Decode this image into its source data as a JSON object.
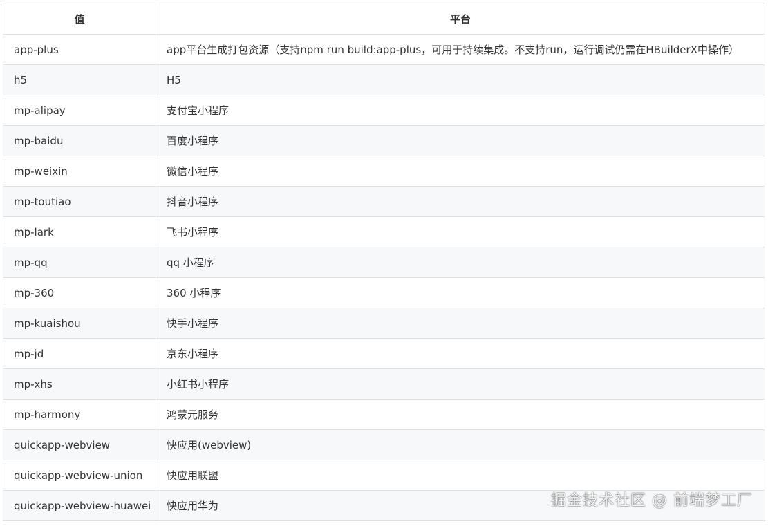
{
  "table": {
    "headers": [
      "值",
      "平台"
    ],
    "rows": [
      [
        "app-plus",
        "app平台生成打包资源（支持npm run build:app-plus，可用于持续集成。不支持run，运行调试仍需在HBuilderX中操作）"
      ],
      [
        "h5",
        "H5"
      ],
      [
        "mp-alipay",
        "支付宝小程序"
      ],
      [
        "mp-baidu",
        "百度小程序"
      ],
      [
        "mp-weixin",
        "微信小程序"
      ],
      [
        "mp-toutiao",
        "抖音小程序"
      ],
      [
        "mp-lark",
        "飞书小程序"
      ],
      [
        "mp-qq",
        "qq 小程序"
      ],
      [
        "mp-360",
        "360 小程序"
      ],
      [
        "mp-kuaishou",
        "快手小程序"
      ],
      [
        "mp-jd",
        "京东小程序"
      ],
      [
        "mp-xhs",
        "小红书小程序"
      ],
      [
        "mp-harmony",
        "鸿蒙元服务"
      ],
      [
        "quickapp-webview",
        "快应用(webview)"
      ],
      [
        "quickapp-webview-union",
        "快应用联盟"
      ],
      [
        "quickapp-webview-huawei",
        "快应用华为"
      ]
    ]
  },
  "watermark": "掘金技术社区 @ 前端梦工厂",
  "colors": {
    "border": "#dfe2e5",
    "stripe": "#f6f8fa",
    "text": "#333333"
  }
}
